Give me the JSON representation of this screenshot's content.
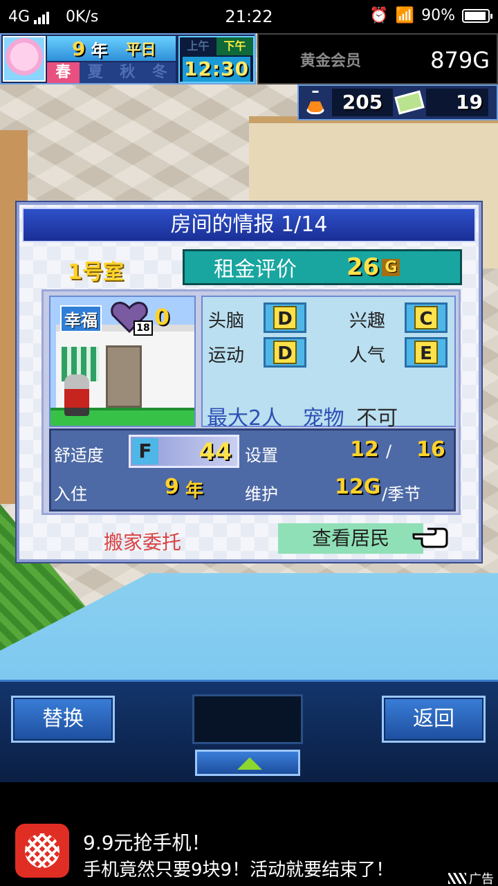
{
  "status_bar": {
    "network": "4G",
    "speed": "0K/s",
    "time": "21:22",
    "battery": "90%"
  },
  "hud": {
    "year_num": "9",
    "year_unit": "年",
    "day_type": "平日",
    "seasons": [
      "春",
      "夏",
      "秋",
      "冬"
    ],
    "active_season": "春",
    "am": "上午",
    "pm": "下午",
    "time": "12:30",
    "membership": "黄金会员",
    "gold": "879G",
    "research_points": "205",
    "tickets": "19"
  },
  "dialog": {
    "title": "房间的情报 1/14",
    "room_name": "1号室",
    "rent_label": "租金评价",
    "rent_value": "26",
    "rent_unit": "G",
    "happiness_label": "幸福",
    "age": "18",
    "happiness_value": "0",
    "stats": [
      {
        "label": "头脑",
        "grade": "D"
      },
      {
        "label": "运动",
        "grade": "D"
      },
      {
        "label": "兴趣",
        "grade": "C"
      },
      {
        "label": "人气",
        "grade": "E"
      }
    ],
    "capacity_label": "最大",
    "capacity_value": "2人",
    "pet_label": "宠物",
    "pet_value": "不可",
    "comfort_label": "舒适度",
    "comfort_grade": "F",
    "comfort_value": "44",
    "facility_label": "设置",
    "facility_used": "12",
    "facility_sep": "/",
    "facility_max": "16",
    "residence_label": "入住",
    "residence_years": "9",
    "residence_unit": "年",
    "maintenance_label": "维护",
    "maintenance_value": "12G",
    "maintenance_unit": "/季节",
    "move_request": "搬家委托",
    "view_residents": "查看居民"
  },
  "toolbar": {
    "replace": "替换",
    "back": "返回"
  },
  "ad": {
    "title": "9.9元抢手机！",
    "desc": "手机竟然只要9块9！活动就要结束了！",
    "tag": "广告"
  }
}
